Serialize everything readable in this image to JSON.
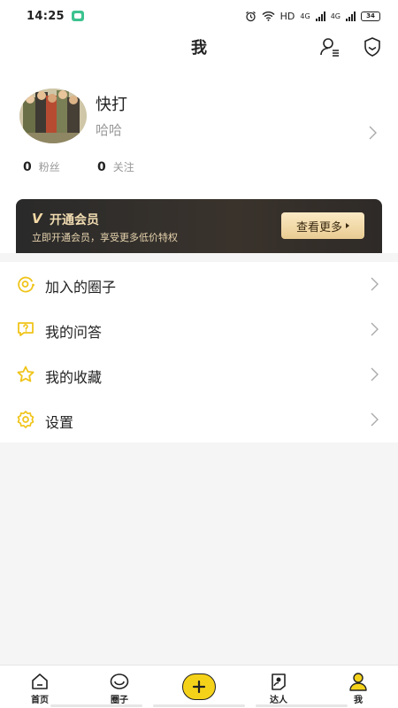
{
  "status_bar": {
    "time": "14:25",
    "network": "HD",
    "signal_1": "4G",
    "signal_2": "4G",
    "battery": "34"
  },
  "header": {
    "title": "我",
    "icons": [
      "user-list-icon",
      "shield-icon"
    ]
  },
  "profile": {
    "username": "快打",
    "bio": "哈哈",
    "fans_count": "0",
    "fans_label": "粉丝",
    "following_count": "0",
    "following_label": "关注"
  },
  "vip": {
    "badge": "V",
    "title": "开通会员",
    "subtitle": "立即开通会员，享受更多低价特权",
    "button_label": "查看更多"
  },
  "menu": {
    "items": [
      {
        "label": "加入的圈子",
        "icon": "circle-join-icon"
      },
      {
        "label": "我的问答",
        "icon": "qa-bubble-icon"
      },
      {
        "label": "我的收藏",
        "icon": "star-icon"
      },
      {
        "label": "设置",
        "icon": "gear-icon"
      }
    ]
  },
  "bottom_nav": {
    "items": [
      {
        "label": "首页",
        "icon": "home-icon"
      },
      {
        "label": "圈子",
        "icon": "circle-icon"
      },
      {
        "label": "",
        "icon": "add-icon"
      },
      {
        "label": "达人",
        "icon": "expert-icon"
      },
      {
        "label": "我",
        "icon": "profile-icon"
      }
    ]
  },
  "colors": {
    "accent": "#f5d21a",
    "icon_yellow": "#f0c419",
    "vip_dark": "#2a2a2a",
    "vip_gold": "#e9cc92"
  }
}
